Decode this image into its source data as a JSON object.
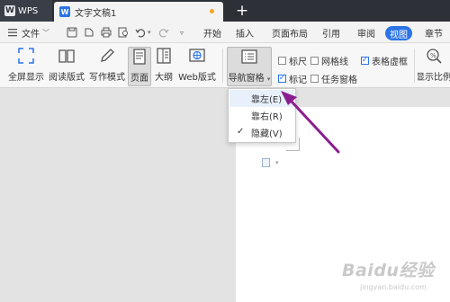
{
  "titlebar": {
    "app_tab": "WPS",
    "doc_tab": "文字文稿1",
    "new_tab_symbol": "+"
  },
  "menubar": {
    "file_label": "文件",
    "tabs": [
      {
        "label": "开始"
      },
      {
        "label": "插入"
      },
      {
        "label": "页面布局"
      },
      {
        "label": "引用"
      },
      {
        "label": "审阅"
      },
      {
        "label": "视图",
        "active": true
      },
      {
        "label": "章节"
      }
    ]
  },
  "ribbon": {
    "buttons": [
      {
        "label": "全屏显示",
        "icon": "fullscreen-icon"
      },
      {
        "label": "阅读版式",
        "icon": "book-icon"
      },
      {
        "label": "写作模式",
        "icon": "pen-icon"
      },
      {
        "label": "页面",
        "icon": "page-icon",
        "pressed": true
      },
      {
        "label": "大纲",
        "icon": "outline-icon"
      },
      {
        "label": "Web版式",
        "icon": "web-icon"
      },
      {
        "label": "导航窗格",
        "icon": "nav-pane-icon",
        "has_dropdown": true
      },
      {
        "label": "显示比例",
        "icon": "zoom-icon"
      }
    ],
    "checkboxes": [
      {
        "label": "标尺",
        "checked": false
      },
      {
        "label": "网格线",
        "checked": false
      },
      {
        "label": "表格虚框",
        "checked": true
      },
      {
        "label": "标记",
        "checked": true
      },
      {
        "label": "任务窗格",
        "checked": false
      }
    ]
  },
  "dropdown": {
    "items": [
      {
        "label": "靠左(E)",
        "hovered": true,
        "checked": false
      },
      {
        "label": "靠右(R)",
        "hovered": false,
        "checked": false
      },
      {
        "label": "隐藏(V)",
        "hovered": false,
        "checked": true
      }
    ]
  },
  "watermark": {
    "text": "Baidu经验",
    "url": "jingyan.baidu.com"
  },
  "colors": {
    "accent": "#2b74e6",
    "titlebar": "#2d3037",
    "arrow": "#8b1e8f"
  }
}
